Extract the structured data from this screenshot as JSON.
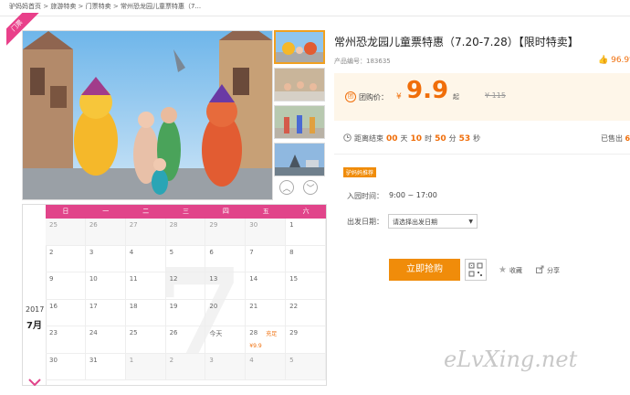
{
  "breadcrumb": [
    "驴妈妈首页",
    "旅游特卖",
    "门票特卖",
    "常州恐龙园儿童票特惠（7..."
  ],
  "corner_badge": "门票",
  "product": {
    "title": "常州恐龙园儿童票特惠（7.20-7.28）【限时特卖】",
    "id_label": "产品编号：",
    "id": "183635",
    "rating": "96.9"
  },
  "price": {
    "icon": "团",
    "label": "团购价：",
    "yen": "¥",
    "value": "9.9",
    "suffix": "起",
    "original": "¥ 115"
  },
  "countdown": {
    "label": "距离结束",
    "days": "00",
    "days_unit": "天",
    "hours": "10",
    "hours_unit": "时",
    "minutes": "50",
    "minutes_unit": "分",
    "seconds": "53",
    "seconds_unit": "秒"
  },
  "sold": {
    "label": "已售出",
    "value": "6"
  },
  "tag": "驴妈妈推荐",
  "entry": {
    "label": "入园时间：",
    "value": "9:00 ~ 17:00"
  },
  "departure": {
    "label": "出发日期：",
    "placeholder": "请选择出发日期"
  },
  "actions": {
    "buy": "立即抢购",
    "favorite": "收藏",
    "share": "分享"
  },
  "calendar": {
    "year": "2017",
    "month": "7月",
    "big_month": "7",
    "weekdays": [
      "日",
      "一",
      "二",
      "三",
      "四",
      "五",
      "六"
    ],
    "rows": [
      [
        {
          "d": "25",
          "g": true
        },
        {
          "d": "26",
          "g": true
        },
        {
          "d": "27",
          "g": true
        },
        {
          "d": "28",
          "g": true
        },
        {
          "d": "29",
          "g": true
        },
        {
          "d": "30",
          "g": true
        },
        {
          "d": "1",
          "g": false
        }
      ],
      [
        {
          "d": "2",
          "g": false
        },
        {
          "d": "3",
          "g": false
        },
        {
          "d": "4",
          "g": false
        },
        {
          "d": "5",
          "g": false
        },
        {
          "d": "6",
          "g": false
        },
        {
          "d": "7",
          "g": false
        },
        {
          "d": "8",
          "g": false
        }
      ],
      [
        {
          "d": "9",
          "g": false
        },
        {
          "d": "10",
          "g": false
        },
        {
          "d": "11",
          "g": false
        },
        {
          "d": "12",
          "g": false
        },
        {
          "d": "13",
          "g": false
        },
        {
          "d": "14",
          "g": false
        },
        {
          "d": "15",
          "g": false
        }
      ],
      [
        {
          "d": "16",
          "g": false
        },
        {
          "d": "17",
          "g": false
        },
        {
          "d": "18",
          "g": false
        },
        {
          "d": "19",
          "g": false
        },
        {
          "d": "20",
          "g": false
        },
        {
          "d": "21",
          "g": false
        },
        {
          "d": "22",
          "g": false
        }
      ],
      [
        {
          "d": "23",
          "g": false
        },
        {
          "d": "24",
          "g": false
        },
        {
          "d": "25",
          "g": false
        },
        {
          "d": "26",
          "g": false
        },
        {
          "d": "今天",
          "g": false
        },
        {
          "d": "28",
          "g": false,
          "tag": "充足",
          "price": "¥9.9"
        },
        {
          "d": "29",
          "g": false
        }
      ],
      [
        {
          "d": "30",
          "g": false
        },
        {
          "d": "31",
          "g": false
        },
        {
          "d": "1",
          "g": true
        },
        {
          "d": "2",
          "g": true
        },
        {
          "d": "3",
          "g": true
        },
        {
          "d": "4",
          "g": true
        },
        {
          "d": "5",
          "g": true
        }
      ]
    ]
  },
  "watermark": "eLvXing.net",
  "colors": {
    "accent": "#f08c0a",
    "calendar": "#e1448a",
    "price": "#f06e0a"
  }
}
